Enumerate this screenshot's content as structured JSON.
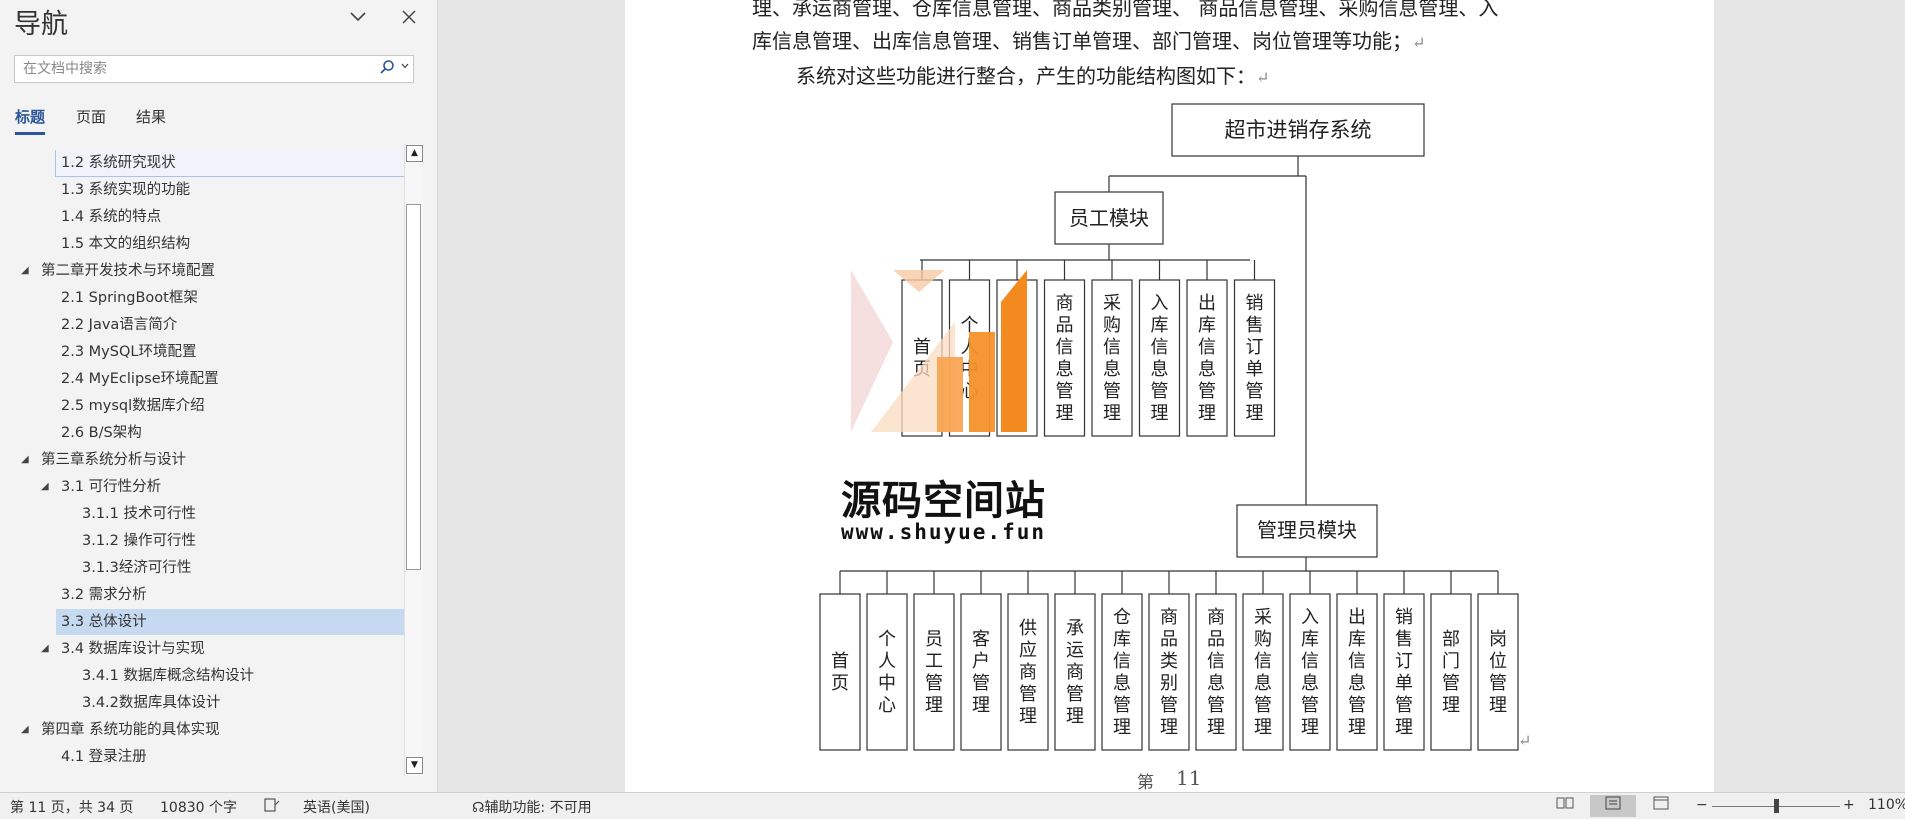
{
  "nav": {
    "title": "导航",
    "collapse_icon": "chevron-down-icon",
    "close_icon": "close-icon",
    "search_placeholder": "在文档中搜索",
    "tabs": [
      "标题",
      "页面",
      "结果"
    ],
    "items": [
      {
        "label": "1.2  系统研究现状"
      },
      {
        "label": "1.3  系统实现的功能"
      },
      {
        "label": "1.4  系统的特点"
      },
      {
        "label": "1.5  本文的组织结构"
      },
      {
        "label": "第二章开发技术与环境配置"
      },
      {
        "label": "2.1  SpringBoot框架"
      },
      {
        "label": " 2.2  Java语言简介"
      },
      {
        "label": "2.3  MySQL环境配置"
      },
      {
        "label": "2.4  MyEclipse环境配置"
      },
      {
        "label": "2.5  mysql数据库介绍"
      },
      {
        "label": "2.6  B/S架构"
      },
      {
        "label": "第三章系统分析与设计"
      },
      {
        "label": "3.1 可行性分析"
      },
      {
        "label": "3.1.1 技术可行性"
      },
      {
        "label": "3.1.2 操作可行性"
      },
      {
        "label": "3.1.3经济可行性"
      },
      {
        "label": "3.2  需求分析"
      },
      {
        "label": "3.3  总体设计"
      },
      {
        "label": "3.4  数据库设计与实现"
      },
      {
        "label": "3.4.1  数据库概念结构设计"
      },
      {
        "label": "3.4.2数据库具体设计"
      },
      {
        "label": "第四章  系统功能的具体实现"
      },
      {
        "label": "4.1 登录注册"
      }
    ]
  },
  "doc": {
    "line1": "理、承运商管理、仓库信息管理、商品类别管理、 商品信息管理、采购信息管理、入",
    "line2": "库信息管理、出库信息管理、销售订单管理、部门管理、岗位管理等功能；",
    "line3": "系统对这些功能进行整合，产生的功能结构图如下：",
    "para_mark": "↵",
    "page_label": "第",
    "page_num": "11"
  },
  "diagram": {
    "root": "超市进销存系统",
    "employee_module": "员工模块",
    "employee_children": [
      "首页",
      "个人中心",
      "仓库信息管理",
      "商品信息管理",
      "采购信息管理",
      "入库信息管理",
      "出库信息管理",
      "销售订单管理"
    ],
    "admin_module": "管理员模块",
    "admin_children": [
      "首页",
      "个人中心",
      "员工管理",
      "客户管理",
      "供应商管理",
      "承运商管理",
      "仓库信息管理",
      "商品类别管理",
      "商品信息管理",
      "采购信息管理",
      "入库信息管理",
      "出库信息管理",
      "销售订单管理",
      "部门管理",
      "岗位管理"
    ]
  },
  "watermark": {
    "title": "源码空间站",
    "url": "www.shuyue.fun"
  },
  "status": {
    "page": "第 11 页，共 34 页",
    "words": "10830 个字",
    "language": "英语(美国)",
    "accessibility": "辅助功能: 不可用",
    "zoom_minus": "−",
    "zoom_plus": "+",
    "zoom": "110%"
  }
}
